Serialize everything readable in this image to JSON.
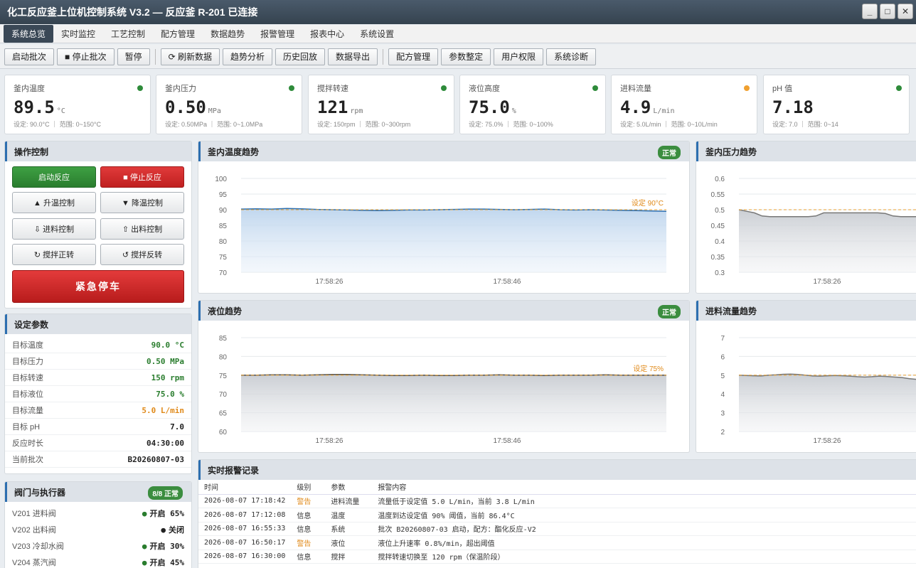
{
  "window": {
    "title": "化工反应釜上位机控制系统 V3.2 — 反应釜 R-201 已连接",
    "min": "_",
    "max": "□",
    "close": "✕"
  },
  "menu": [
    "系统总览",
    "实时监控",
    "工艺控制",
    "配方管理",
    "数据趋势",
    "报警管理",
    "报表中心",
    "系统设置"
  ],
  "toolbar": {
    "g1": [
      "启动批次",
      "■ 停止批次",
      "暂停"
    ],
    "g2": [
      "⟳ 刷新数据",
      "趋势分析",
      "历史回放",
      "数据导出"
    ],
    "g3": [
      "配方管理",
      "参数整定",
      "用户权限",
      "系统诊断"
    ]
  },
  "cards": [
    {
      "label": "釜内温度",
      "value": "89.5",
      "unit": "°C",
      "sub": "设定: 90.0°C ｜ 范围: 0~150°C",
      "status": "ok"
    },
    {
      "label": "釜内压力",
      "value": "0.50",
      "unit": "MPa",
      "sub": "设定: 0.50MPa ｜ 范围: 0~1.0MPa",
      "status": "ok"
    },
    {
      "label": "搅拌转速",
      "value": "121",
      "unit": "rpm",
      "sub": "设定: 150rpm ｜ 范围: 0~300rpm",
      "status": "ok"
    },
    {
      "label": "液位高度",
      "value": "75.0",
      "unit": "%",
      "sub": "设定: 75.0% ｜ 范围: 0~100%",
      "status": "ok"
    },
    {
      "label": "进料流量",
      "value": "4.9",
      "unit": "L/min",
      "sub": "设定: 5.0L/min ｜ 范围: 0~10L/min",
      "status": "warn"
    },
    {
      "label": "pH 值",
      "value": "7.18",
      "unit": "",
      "sub": "设定: 7.0 ｜ 范围: 0~14",
      "status": "ok"
    }
  ],
  "ops": {
    "title": "操作控制",
    "start": "启动反应",
    "stop": "■ 停止反应",
    "heat": "▲ 升温控制",
    "cool": "▼ 降温控制",
    "feed": "⇩ 进料控制",
    "discharge": "⇧ 出料控制",
    "fwd": "↻ 搅拌正转",
    "rev": "↺ 搅拌反转",
    "estop": "紧急停车"
  },
  "params": {
    "title": "设定参数",
    "rows": [
      {
        "k": "目标温度",
        "v": "90.0 °C",
        "c": ""
      },
      {
        "k": "目标压力",
        "v": "0.50 MPa",
        "c": ""
      },
      {
        "k": "目标转速",
        "v": "150 rpm",
        "c": ""
      },
      {
        "k": "目标液位",
        "v": "75.0 %",
        "c": ""
      },
      {
        "k": "目标流量",
        "v": "5.0 L/min",
        "c": "or"
      },
      {
        "k": "目标 pH",
        "v": "7.0",
        "c": "dk"
      },
      {
        "k": "反应时长",
        "v": "04:30:00",
        "c": "dk"
      },
      {
        "k": "当前批次",
        "v": "B20260807-03",
        "c": "dk"
      }
    ]
  },
  "valves": {
    "title": "阀门与执行器",
    "badge": "8/8 正常",
    "rows": [
      {
        "k": "V201 进料阀",
        "v": "开启 65%",
        "on": true
      },
      {
        "k": "V202 出料阀",
        "v": "关闭",
        "on": false
      },
      {
        "k": "V203 冷却水阀",
        "v": "开启 30%",
        "on": true
      },
      {
        "k": "V204 蒸汽阀",
        "v": "开启 45%",
        "on": true
      }
    ]
  },
  "alarms": {
    "title": "实时报警记录",
    "headers": [
      "时间",
      "级别",
      "参数",
      "报警内容"
    ],
    "rows": [
      [
        "2026-08-07 17:18:42",
        "警告",
        "进料流量",
        "流量低于设定值 5.0 L/min，当前 3.8 L/min"
      ],
      [
        "2026-08-07 17:12:08",
        "信息",
        "温度",
        "温度到达设定值 90% 阈值，当前 86.4°C"
      ],
      [
        "2026-08-07 16:55:33",
        "信息",
        "系统",
        "批次 B20260807-03 启动，配方：酯化反应-V2"
      ],
      [
        "2026-08-07 16:50:17",
        "警告",
        "液位",
        "液位上升速率 0.8%/min，超出阈值"
      ],
      [
        "2026-08-07 16:30:00",
        "信息",
        "搅拌",
        "搅拌转速切换至 120 rpm（保温阶段）"
      ]
    ]
  },
  "chart_data": [
    {
      "type": "area",
      "title": "釜内温度趋势",
      "badge": "正常",
      "x_ticks": [
        "17:58:26",
        "17:58:46"
      ],
      "ylim": [
        70,
        100
      ],
      "y_ticks": [
        "100",
        "95",
        "90",
        "85",
        "80",
        "75",
        "70"
      ],
      "setpoint": 90,
      "setpoint_label": "设定 90°C",
      "color": "#2d6fb0",
      "values": [
        90.2,
        90.3,
        90.2,
        90.4,
        90.3,
        90.1,
        90.0,
        89.9,
        89.8,
        89.7,
        89.8,
        89.9,
        89.9,
        90.0,
        90.1,
        90.2,
        90.2,
        90.1,
        90.0,
        90.1,
        90.2,
        90.0,
        89.9,
        90.0,
        89.9,
        89.8,
        89.7,
        89.6,
        89.5
      ]
    },
    {
      "type": "area",
      "title": "釜内压力趋势",
      "x_ticks": [
        "17:58:26"
      ],
      "ylim": [
        0.3,
        0.6
      ],
      "y_ticks": [
        "0.6",
        "0.55",
        "0.5",
        "0.45",
        "0.4",
        "0.35",
        "0.3"
      ],
      "setpoint": 0.5,
      "setpoint_label": "",
      "color": "#777",
      "values": [
        0.5,
        0.495,
        0.49,
        0.48,
        0.478,
        0.478,
        0.478,
        0.478,
        0.478,
        0.478,
        0.48,
        0.49,
        0.49,
        0.49,
        0.49,
        0.49,
        0.49,
        0.49,
        0.49,
        0.488,
        0.48,
        0.478,
        0.478,
        0.478,
        0.478
      ]
    },
    {
      "type": "area",
      "title": "液位趋势",
      "badge": "正常",
      "x_ticks": [
        "17:58:26",
        "17:58:46"
      ],
      "ylim": [
        60,
        85
      ],
      "y_ticks": [
        "85",
        "80",
        "75",
        "70",
        "65",
        "60"
      ],
      "setpoint": 75,
      "setpoint_label": "设定 75%",
      "color": "#555",
      "values": [
        75.0,
        75.0,
        75.1,
        75.1,
        75.0,
        75.1,
        75.2,
        75.2,
        75.1,
        75.0,
        74.9,
        74.9,
        75.0,
        74.9,
        74.9,
        75.0,
        75.0,
        75.1,
        75.0,
        75.0,
        74.9,
        75.0,
        75.0,
        75.0,
        75.1,
        75.0,
        75.0,
        75.0,
        75.0
      ]
    },
    {
      "type": "area",
      "title": "进料流量趋势",
      "x_ticks": [
        "17:58:26"
      ],
      "ylim": [
        2,
        7
      ],
      "y_ticks": [
        "7",
        "6",
        "5",
        "4",
        "3",
        "2"
      ],
      "setpoint": 5,
      "setpoint_label": "",
      "color": "#777",
      "values": [
        5.0,
        4.98,
        4.97,
        4.96,
        5.0,
        5.02,
        5.05,
        5.06,
        5.04,
        5.0,
        4.96,
        4.95,
        4.97,
        4.98,
        4.97,
        4.95,
        4.92,
        4.9,
        4.92,
        4.95,
        4.93,
        4.9,
        4.88,
        4.82,
        4.78,
        4.75
      ]
    }
  ]
}
